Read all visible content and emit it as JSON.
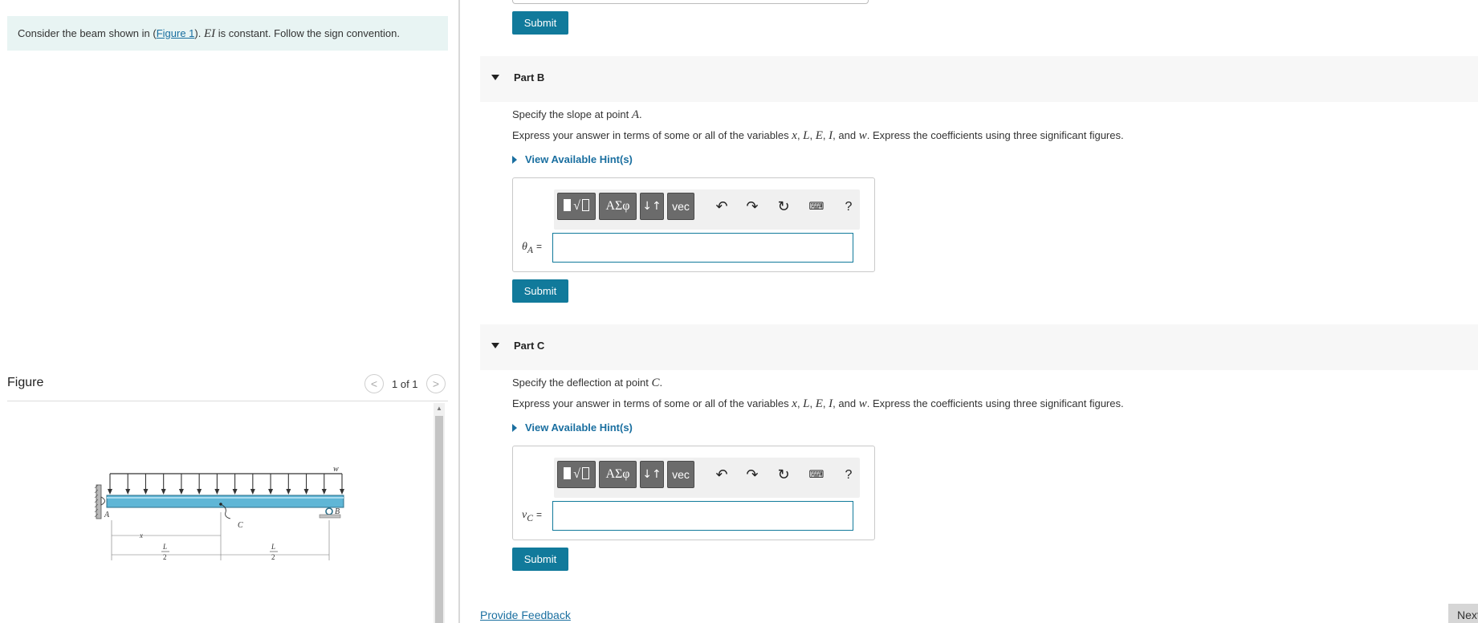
{
  "intro": {
    "prefix": "Consider the beam shown in (",
    "figure_link": "Figure 1",
    "suffix_after_link": ").",
    "math": "EI",
    "suffix": " is constant. Follow the sign convention."
  },
  "figure": {
    "title": "Figure",
    "count": "1 of 1",
    "labels": {
      "w": "w",
      "a": "A",
      "b": "B",
      "c": "C",
      "x": "x",
      "l": "L",
      "half_den": "2"
    }
  },
  "buttons": {
    "submit": "Submit",
    "next": "Next"
  },
  "parts": [
    {
      "title": "Part B",
      "question_prefix": "Specify the slope at point ",
      "question_var": "A",
      "question_suffix": ".",
      "answer_label": "θ",
      "answer_sub": "A",
      "answer_eq": "="
    },
    {
      "title": "Part C",
      "question_prefix": "Specify the deflection at point ",
      "question_var": "C",
      "question_suffix": ".",
      "answer_label": "v",
      "answer_sub": "C",
      "answer_eq": "="
    }
  ],
  "instructions": {
    "prefix": "Express your answer in terms of some or all of the variables ",
    "vars": [
      "x",
      "L",
      "E",
      "I"
    ],
    "and": "and",
    "last_var": "w",
    "suffix": ". Express the coefficients using three significant figures."
  },
  "hint": "View Available Hint(s)",
  "toolbar": {
    "greek": "ΑΣφ",
    "arrows": "↓↑",
    "vec": "vec",
    "undo_icon": "undo-icon",
    "redo_icon": "redo-icon",
    "reset_icon": "reset-icon",
    "keyboard_icon": "keyboard-icon",
    "help": "?"
  },
  "footer": {
    "feedback": "Provide Feedback"
  },
  "colors": {
    "accent": "#117a9b",
    "link": "#1a6fa0",
    "intro_bg": "#e8f4f3",
    "beam": "#5fb6d6"
  }
}
